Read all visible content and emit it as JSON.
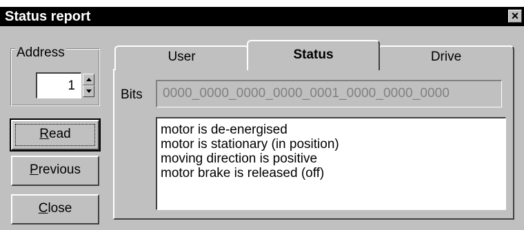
{
  "window": {
    "title": "Status report",
    "close_glyph": "×"
  },
  "address": {
    "label": "Address",
    "value": "1"
  },
  "buttons": {
    "read": {
      "mnemonic": "R",
      "rest": "ead"
    },
    "previous": {
      "mnemonic": "P",
      "rest": "revious"
    },
    "close": {
      "mnemonic": "C",
      "rest": "lose"
    }
  },
  "tabs": [
    {
      "label": "User",
      "selected": false
    },
    {
      "label": "Status",
      "selected": true
    },
    {
      "label": "Drive",
      "selected": false
    }
  ],
  "bits": {
    "label": "Bits",
    "value": "0000_0000_0000_0000_0001_0000_0000_0000"
  },
  "status_lines": [
    "motor is de-energised",
    "motor is stationary (in position)",
    "moving direction is positive",
    "motor brake is released (off)"
  ],
  "colors": {
    "face": "#c0c0c0",
    "titlebar": "#000000",
    "disabled_text": "#808080"
  }
}
